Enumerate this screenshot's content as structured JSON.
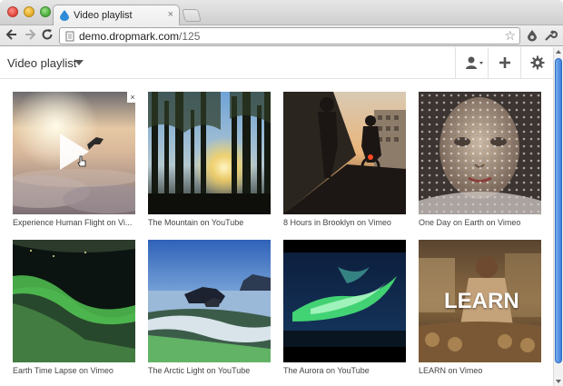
{
  "browser": {
    "tab_title": "Video playlist",
    "tab_close": "×",
    "url_host": "demo.dropmark.com",
    "url_path": "/125",
    "star": "☆"
  },
  "app": {
    "title": "Video playlist",
    "accent_color": "#3c7fd9"
  },
  "items": [
    {
      "caption": "Experience Human Flight on Vi...",
      "thumbnail": "skydiver-over-clouds",
      "has_play": true,
      "remove": "×"
    },
    {
      "caption": "The Mountain on YouTube",
      "thumbnail": "sun-through-forest"
    },
    {
      "caption": "8 Hours in Brooklyn on Vimeo",
      "thumbnail": "city-street-cyclists"
    },
    {
      "caption": "One Day on Earth on Vimeo",
      "thumbnail": "face-with-lace-veil"
    },
    {
      "caption": "Earth Time Lapse on Vimeo",
      "thumbnail": "aurora-from-orbit"
    },
    {
      "caption": "The Arctic Light on YouTube",
      "thumbnail": "arctic-coast-rocks"
    },
    {
      "caption": "The Aurora on YouTube",
      "thumbnail": "green-aurora"
    },
    {
      "caption": "LEARN on Vimeo",
      "thumbnail": "learn-poster",
      "overlay_text": "LEARN"
    }
  ]
}
